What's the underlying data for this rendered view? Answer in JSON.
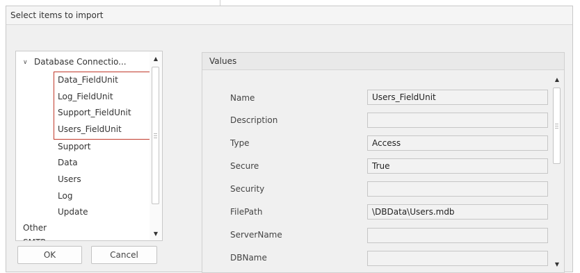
{
  "dialog": {
    "title": "Select items to import"
  },
  "tree": {
    "items": [
      {
        "label": "Database Connectio...",
        "expander": "∨"
      },
      {
        "label": "Data_FieldUnit"
      },
      {
        "label": "Log_FieldUnit"
      },
      {
        "label": "Support_FieldUnit"
      },
      {
        "label": "Users_FieldUnit"
      },
      {
        "label": "Support"
      },
      {
        "label": "Data"
      },
      {
        "label": "Users"
      },
      {
        "label": "Log"
      },
      {
        "label": "Update"
      },
      {
        "label": "Other"
      },
      {
        "label": "SMTP"
      }
    ],
    "highlight_color": "#c0392b"
  },
  "buttons": {
    "ok_label": "OK",
    "cancel_label": "Cancel"
  },
  "values": {
    "header": "Values",
    "properties": [
      {
        "label": "Name",
        "value": "Users_FieldUnit"
      },
      {
        "label": "Description",
        "value": ""
      },
      {
        "label": "Type",
        "value": "Access"
      },
      {
        "label": "Secure",
        "value": "True"
      },
      {
        "label": "Security",
        "value": ""
      },
      {
        "label": "FilePath",
        "value": "\\DBData\\Users.mdb"
      },
      {
        "label": "ServerName",
        "value": ""
      },
      {
        "label": "DBName",
        "value": ""
      }
    ]
  },
  "icons": {
    "scroll_up": "▲",
    "scroll_down": "▼"
  }
}
